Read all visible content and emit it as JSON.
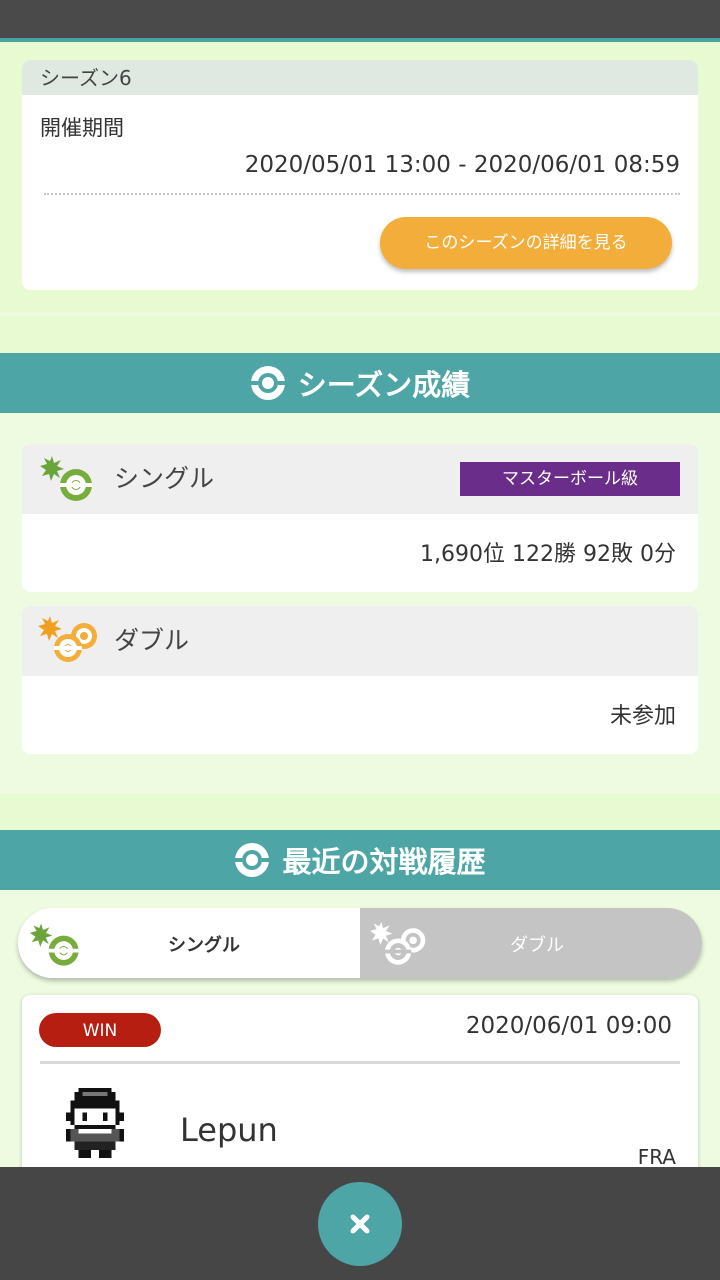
{
  "season": {
    "name": "シーズン6",
    "period_label": "開催期間",
    "period_range": "2020/05/01 13:00 - 2020/06/01 08:59",
    "detail_button": "このシーズンの詳細を見る"
  },
  "season_results": {
    "title": "シーズン成績",
    "single": {
      "label": "シングル",
      "rank_badge": "マスターボール級",
      "stats": "1,690位 122勝 92敗 0分"
    },
    "double": {
      "label": "ダブル",
      "stats": "未参加"
    }
  },
  "recent_battles": {
    "title": "最近の対戦履歴",
    "tabs": [
      {
        "label": "シングル",
        "active": true
      },
      {
        "label": "ダブル",
        "active": false
      }
    ],
    "entries": [
      {
        "result": "WIN",
        "datetime": "2020/06/01 09:00",
        "opponent": "Lepun",
        "country": "FRA"
      }
    ]
  },
  "colors": {
    "teal": "#4da5a6",
    "orange": "#f3ad3a",
    "master_purple": "#6b2d8a",
    "win_red": "#b71e12",
    "single_green": "#78ac3c"
  },
  "icons": {
    "section": "pokeball-icon",
    "single": "single-battle-icon",
    "double": "double-battle-icon",
    "close": "close-icon"
  }
}
